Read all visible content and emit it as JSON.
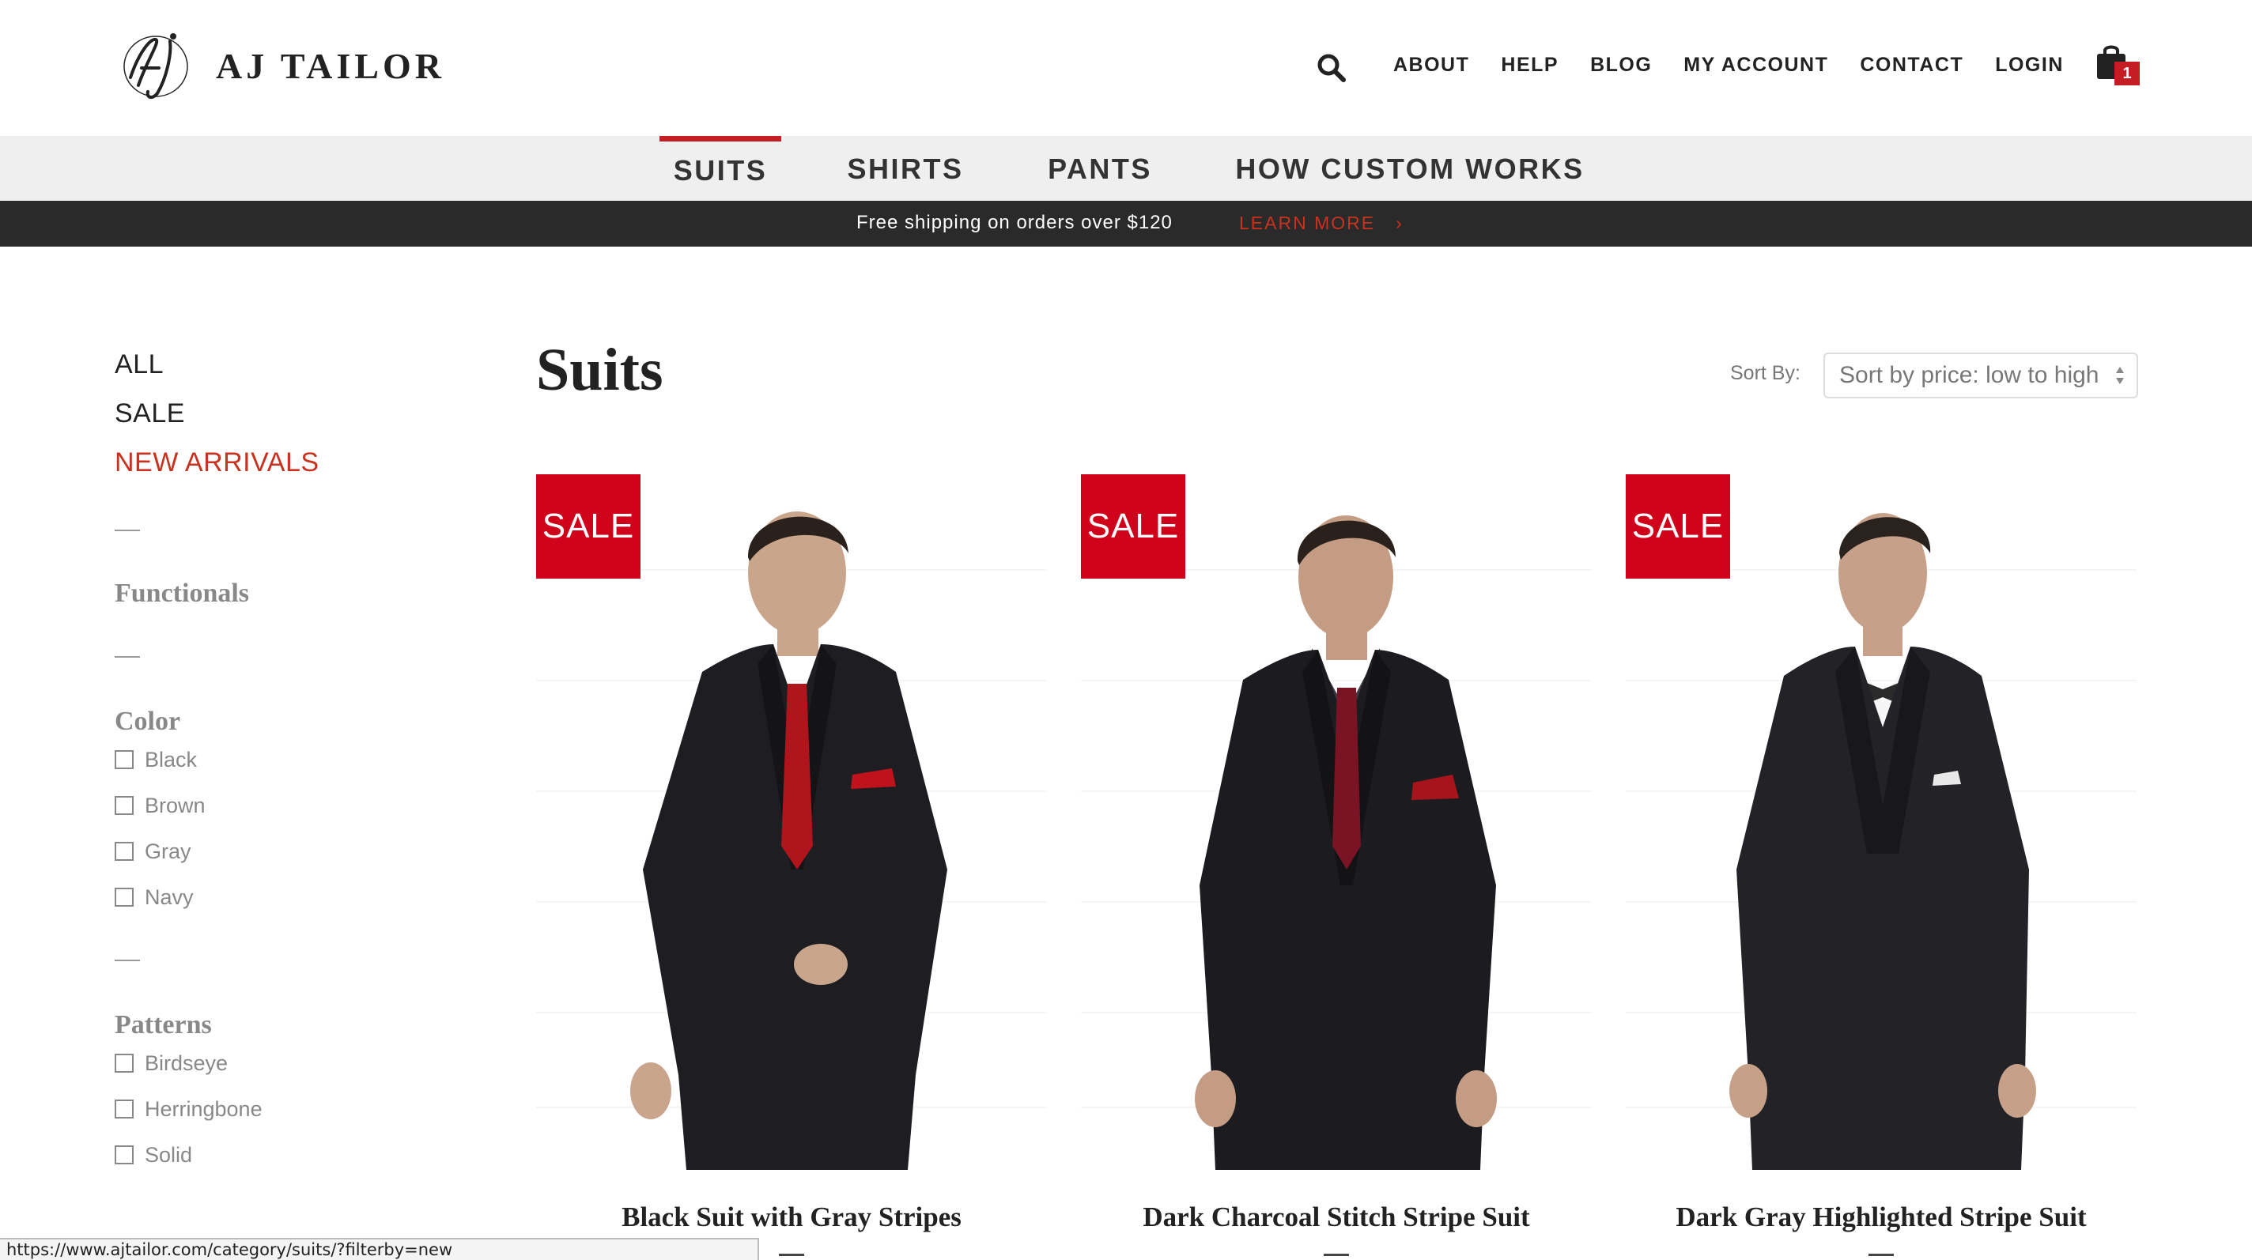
{
  "brand": {
    "name": "AJ TAILOR",
    "monogram": "Aj"
  },
  "topnav": {
    "search_icon": "search-icon",
    "items": [
      "ABOUT",
      "HELP",
      "BLOG",
      "MY ACCOUNT",
      "CONTACT",
      "LOGIN"
    ],
    "cart_icon": "shopping-bag-icon",
    "cart_count": "1"
  },
  "categories": {
    "items": [
      "SUITS",
      "SHIRTS",
      "PANTS",
      "HOW CUSTOM WORKS"
    ],
    "active": "SUITS"
  },
  "promo": {
    "text": "Free shipping on orders over $120",
    "link": "LEARN MORE",
    "link_icon": "chevron-right-icon"
  },
  "sidebar": {
    "links": [
      "ALL",
      "SALE",
      "NEW ARRIVALS"
    ],
    "active_link": "NEW ARRIVALS",
    "functionals_title": "Functionals",
    "color_title": "Color",
    "colors": [
      "Black",
      "Brown",
      "Gray",
      "Navy"
    ],
    "patterns_title": "Patterns",
    "patterns": [
      "Birdseye",
      "Herringbone",
      "Solid"
    ]
  },
  "main": {
    "title": "Suits",
    "sort_label": "Sort By:",
    "sort_value": "Sort by price: low to high"
  },
  "products": [
    {
      "badge": "SALE",
      "name": "Black Suit with Gray Stripes",
      "tie": "red solid tie"
    },
    {
      "badge": "SALE",
      "name": "Dark Charcoal Stitch Stripe Suit",
      "tie": "burgundy dotted tie"
    },
    {
      "badge": "SALE",
      "name": "Dark Gray Highlighted Stripe Suit",
      "tie": "bow tie"
    }
  ],
  "status_url": "https://www.ajtailor.com/category/suits/?filterby=new",
  "colors": {
    "accent": "#c41e24",
    "promo_bg": "#2a2a2a",
    "catbar_bg": "#efefef",
    "sale_badge": "#d0021b"
  }
}
